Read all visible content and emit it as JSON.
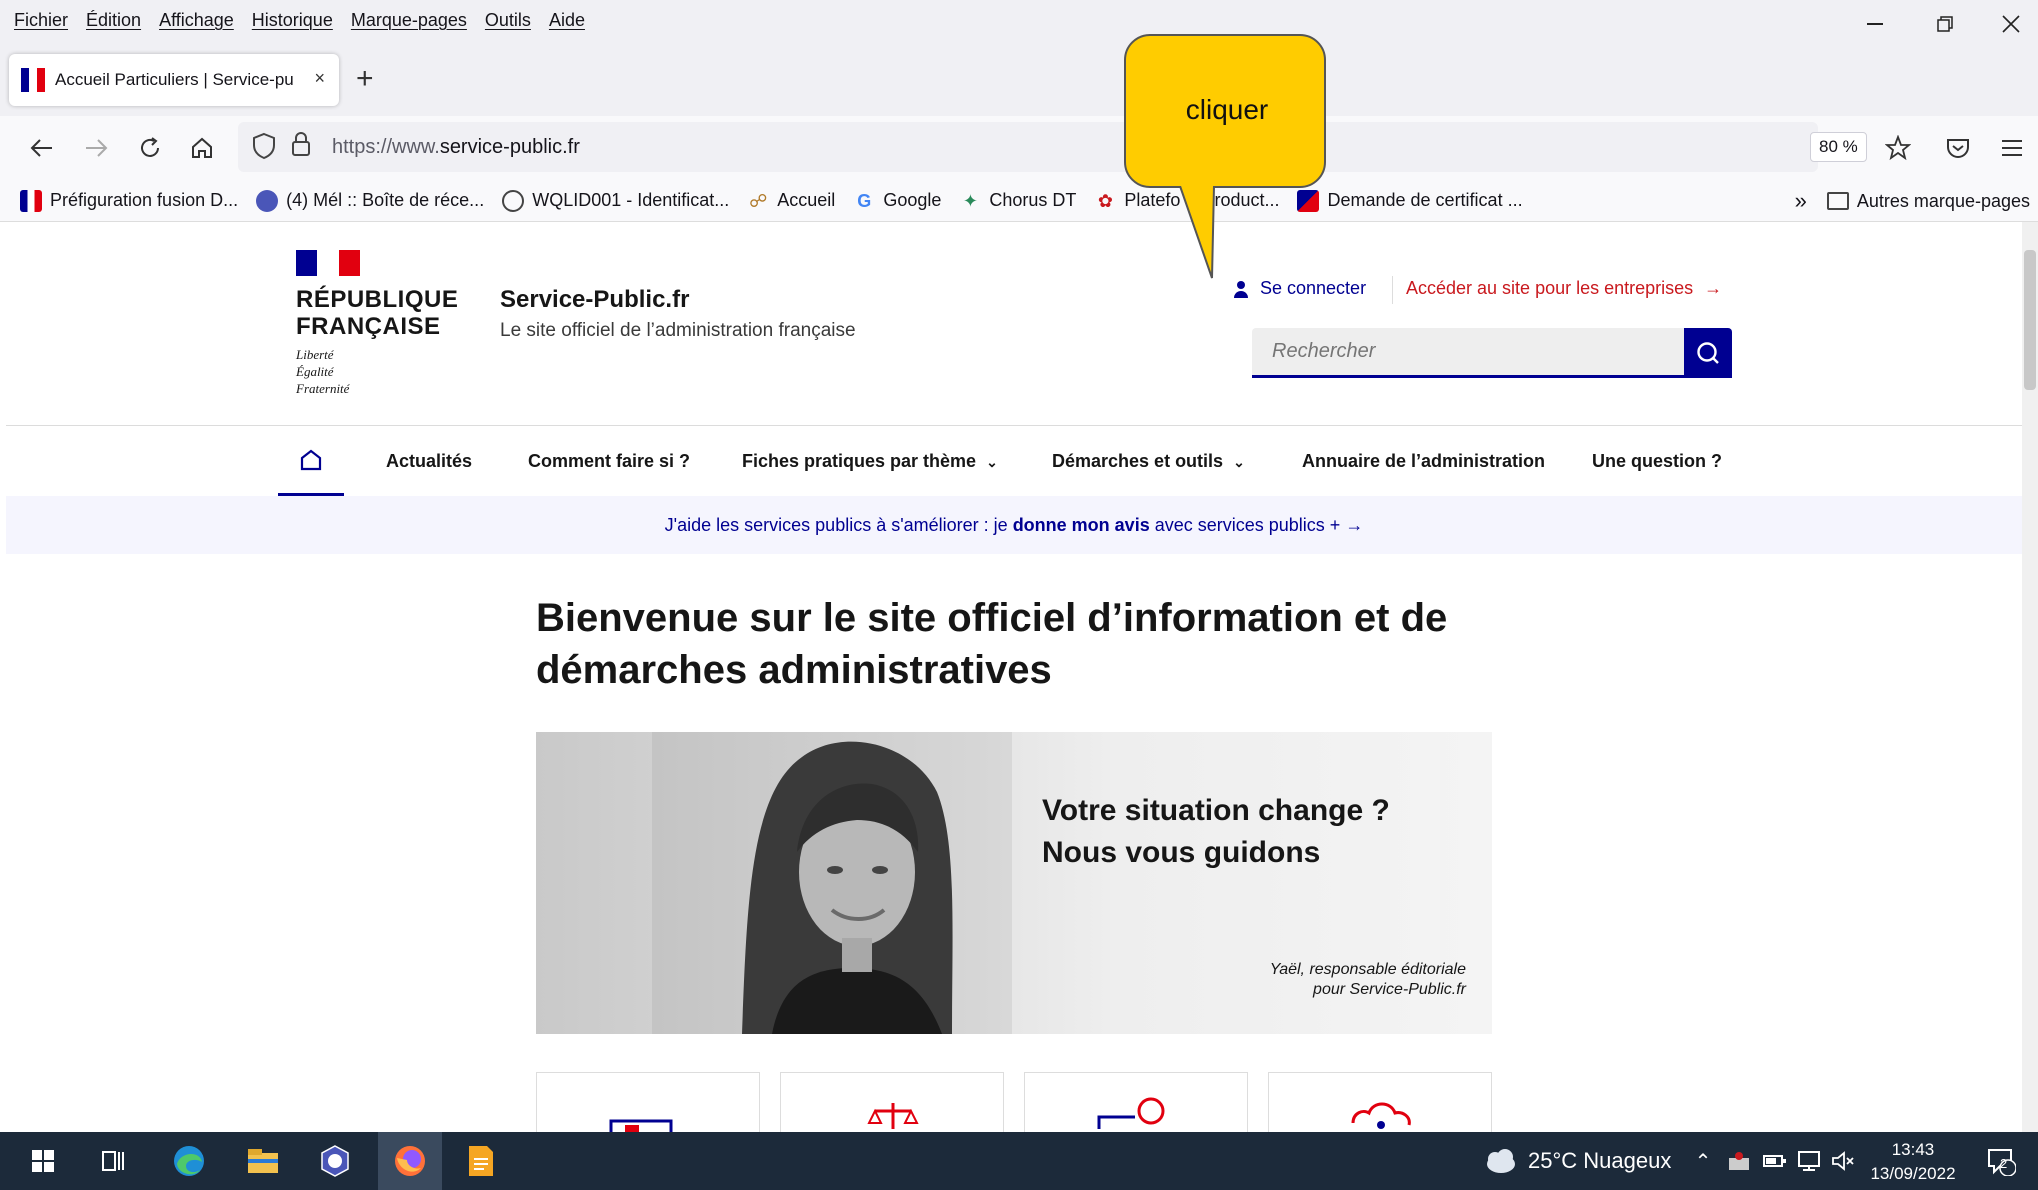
{
  "menubar": {
    "items": [
      "Fichier",
      "Édition",
      "Affichage",
      "Historique",
      "Marque-pages",
      "Outils",
      "Aide"
    ]
  },
  "tab": {
    "title": "Accueil Particuliers | Service-pu",
    "close": "×",
    "new_tab": "+"
  },
  "nav": {
    "url_prefix": "https://www.",
    "url_domain": "service-public.fr",
    "zoom": "80 %"
  },
  "bookmarks": {
    "items": [
      {
        "label": "Préfiguration fusion D...",
        "icon": "rf-flag-icon"
      },
      {
        "label": "(4) Mél :: Boîte de réce...",
        "icon": "mel-icon"
      },
      {
        "label": "WQLID001 - Identificat...",
        "icon": "globe-icon"
      },
      {
        "label": "Accueil",
        "icon": "accueil-icon"
      },
      {
        "label": "Google",
        "icon": "google-icon"
      },
      {
        "label": "Chorus DT",
        "icon": "chorus-icon"
      },
      {
        "label": "Platefo   le product...",
        "icon": "platform-icon"
      },
      {
        "label": "Demande de certificat ...",
        "icon": "sp-icon"
      }
    ],
    "other": "Autres marque-pages"
  },
  "header": {
    "rf_name_1": "RÉPUBLIQUE",
    "rf_name_2": "FRANÇAISE",
    "motto_1": "Liberté",
    "motto_2": "Égalité",
    "motto_3": "Fraternité",
    "site_title": "Service-Public.fr",
    "site_subtitle": "Le site officiel de l’administration française",
    "connect": "Se connecter",
    "entreprises": "Accéder au site pour les entreprises",
    "search_placeholder": "Rechercher"
  },
  "mainnav": {
    "items": [
      {
        "label": "Actualités"
      },
      {
        "label": "Comment faire si ?"
      },
      {
        "label": "Fiches pratiques par thème"
      },
      {
        "label": "Démarches et outils"
      },
      {
        "label": "Annuaire de l’administration"
      },
      {
        "label": "Une question ?"
      }
    ]
  },
  "banner": {
    "text_before": "J'aide les services publics à s'améliorer : je ",
    "text_bold": "donne mon avis",
    "text_after": " avec services publics + "
  },
  "main": {
    "welcome": "Bienvenue sur le site officiel d’information et de démarches administratives",
    "hero_line_1": "Votre situation change ?",
    "hero_line_2": "Nous vous guidons",
    "caption_1": "Yaël, responsable éditoriale",
    "caption_2": "pour Service-Public.fr"
  },
  "callout": {
    "text": "cliquer",
    "color": "#ffcc00"
  },
  "taskbar": {
    "weather": "25°C  Nuageux",
    "time": "13:43",
    "date": "13/09/2022",
    "notifications": "2"
  },
  "colors": {
    "brand_blue": "#000091",
    "brand_red": "#c9191e"
  }
}
